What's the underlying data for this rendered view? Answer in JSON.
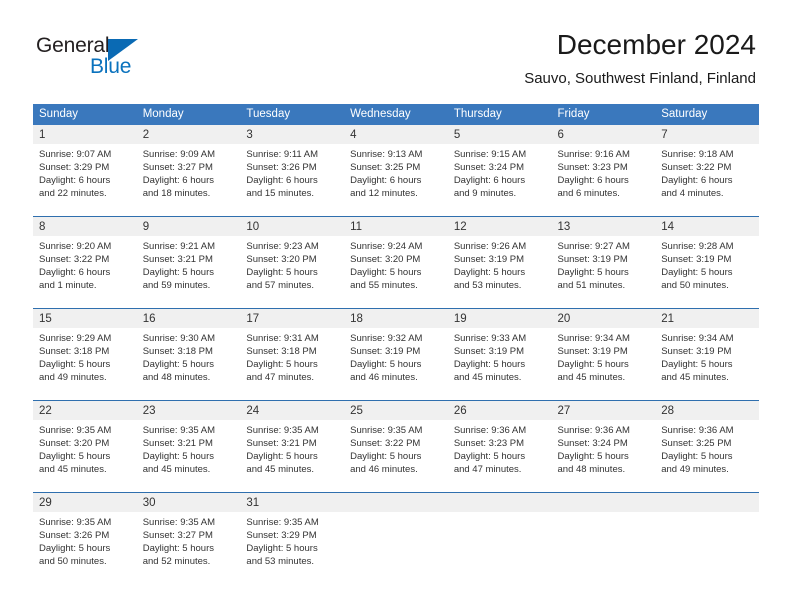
{
  "logo": {
    "word1": "General",
    "word2": "Blue",
    "triangle_color": "#0a6ab4",
    "blue_color": "#0a72bd"
  },
  "header": {
    "title": "December 2024",
    "subtitle": "Sauvo, Southwest Finland, Finland"
  },
  "theme": {
    "header_blue": "#3a78bd",
    "separator_blue": "#2f6fae",
    "day_band_gray": "#f0f0f0",
    "text": "#333333"
  },
  "calendar": {
    "day_headers": [
      "Sunday",
      "Monday",
      "Tuesday",
      "Wednesday",
      "Thursday",
      "Friday",
      "Saturday"
    ],
    "weeks": [
      [
        {
          "day": "1",
          "sunrise": "Sunrise: 9:07 AM",
          "sunset": "Sunset: 3:29 PM",
          "daylight1": "Daylight: 6 hours",
          "daylight2": "and 22 minutes."
        },
        {
          "day": "2",
          "sunrise": "Sunrise: 9:09 AM",
          "sunset": "Sunset: 3:27 PM",
          "daylight1": "Daylight: 6 hours",
          "daylight2": "and 18 minutes."
        },
        {
          "day": "3",
          "sunrise": "Sunrise: 9:11 AM",
          "sunset": "Sunset: 3:26 PM",
          "daylight1": "Daylight: 6 hours",
          "daylight2": "and 15 minutes."
        },
        {
          "day": "4",
          "sunrise": "Sunrise: 9:13 AM",
          "sunset": "Sunset: 3:25 PM",
          "daylight1": "Daylight: 6 hours",
          "daylight2": "and 12 minutes."
        },
        {
          "day": "5",
          "sunrise": "Sunrise: 9:15 AM",
          "sunset": "Sunset: 3:24 PM",
          "daylight1": "Daylight: 6 hours",
          "daylight2": "and 9 minutes."
        },
        {
          "day": "6",
          "sunrise": "Sunrise: 9:16 AM",
          "sunset": "Sunset: 3:23 PM",
          "daylight1": "Daylight: 6 hours",
          "daylight2": "and 6 minutes."
        },
        {
          "day": "7",
          "sunrise": "Sunrise: 9:18 AM",
          "sunset": "Sunset: 3:22 PM",
          "daylight1": "Daylight: 6 hours",
          "daylight2": "and 4 minutes."
        }
      ],
      [
        {
          "day": "8",
          "sunrise": "Sunrise: 9:20 AM",
          "sunset": "Sunset: 3:22 PM",
          "daylight1": "Daylight: 6 hours",
          "daylight2": "and 1 minute."
        },
        {
          "day": "9",
          "sunrise": "Sunrise: 9:21 AM",
          "sunset": "Sunset: 3:21 PM",
          "daylight1": "Daylight: 5 hours",
          "daylight2": "and 59 minutes."
        },
        {
          "day": "10",
          "sunrise": "Sunrise: 9:23 AM",
          "sunset": "Sunset: 3:20 PM",
          "daylight1": "Daylight: 5 hours",
          "daylight2": "and 57 minutes."
        },
        {
          "day": "11",
          "sunrise": "Sunrise: 9:24 AM",
          "sunset": "Sunset: 3:20 PM",
          "daylight1": "Daylight: 5 hours",
          "daylight2": "and 55 minutes."
        },
        {
          "day": "12",
          "sunrise": "Sunrise: 9:26 AM",
          "sunset": "Sunset: 3:19 PM",
          "daylight1": "Daylight: 5 hours",
          "daylight2": "and 53 minutes."
        },
        {
          "day": "13",
          "sunrise": "Sunrise: 9:27 AM",
          "sunset": "Sunset: 3:19 PM",
          "daylight1": "Daylight: 5 hours",
          "daylight2": "and 51 minutes."
        },
        {
          "day": "14",
          "sunrise": "Sunrise: 9:28 AM",
          "sunset": "Sunset: 3:19 PM",
          "daylight1": "Daylight: 5 hours",
          "daylight2": "and 50 minutes."
        }
      ],
      [
        {
          "day": "15",
          "sunrise": "Sunrise: 9:29 AM",
          "sunset": "Sunset: 3:18 PM",
          "daylight1": "Daylight: 5 hours",
          "daylight2": "and 49 minutes."
        },
        {
          "day": "16",
          "sunrise": "Sunrise: 9:30 AM",
          "sunset": "Sunset: 3:18 PM",
          "daylight1": "Daylight: 5 hours",
          "daylight2": "and 48 minutes."
        },
        {
          "day": "17",
          "sunrise": "Sunrise: 9:31 AM",
          "sunset": "Sunset: 3:18 PM",
          "daylight1": "Daylight: 5 hours",
          "daylight2": "and 47 minutes."
        },
        {
          "day": "18",
          "sunrise": "Sunrise: 9:32 AM",
          "sunset": "Sunset: 3:19 PM",
          "daylight1": "Daylight: 5 hours",
          "daylight2": "and 46 minutes."
        },
        {
          "day": "19",
          "sunrise": "Sunrise: 9:33 AM",
          "sunset": "Sunset: 3:19 PM",
          "daylight1": "Daylight: 5 hours",
          "daylight2": "and 45 minutes."
        },
        {
          "day": "20",
          "sunrise": "Sunrise: 9:34 AM",
          "sunset": "Sunset: 3:19 PM",
          "daylight1": "Daylight: 5 hours",
          "daylight2": "and 45 minutes."
        },
        {
          "day": "21",
          "sunrise": "Sunrise: 9:34 AM",
          "sunset": "Sunset: 3:19 PM",
          "daylight1": "Daylight: 5 hours",
          "daylight2": "and 45 minutes."
        }
      ],
      [
        {
          "day": "22",
          "sunrise": "Sunrise: 9:35 AM",
          "sunset": "Sunset: 3:20 PM",
          "daylight1": "Daylight: 5 hours",
          "daylight2": "and 45 minutes."
        },
        {
          "day": "23",
          "sunrise": "Sunrise: 9:35 AM",
          "sunset": "Sunset: 3:21 PM",
          "daylight1": "Daylight: 5 hours",
          "daylight2": "and 45 minutes."
        },
        {
          "day": "24",
          "sunrise": "Sunrise: 9:35 AM",
          "sunset": "Sunset: 3:21 PM",
          "daylight1": "Daylight: 5 hours",
          "daylight2": "and 45 minutes."
        },
        {
          "day": "25",
          "sunrise": "Sunrise: 9:35 AM",
          "sunset": "Sunset: 3:22 PM",
          "daylight1": "Daylight: 5 hours",
          "daylight2": "and 46 minutes."
        },
        {
          "day": "26",
          "sunrise": "Sunrise: 9:36 AM",
          "sunset": "Sunset: 3:23 PM",
          "daylight1": "Daylight: 5 hours",
          "daylight2": "and 47 minutes."
        },
        {
          "day": "27",
          "sunrise": "Sunrise: 9:36 AM",
          "sunset": "Sunset: 3:24 PM",
          "daylight1": "Daylight: 5 hours",
          "daylight2": "and 48 minutes."
        },
        {
          "day": "28",
          "sunrise": "Sunrise: 9:36 AM",
          "sunset": "Sunset: 3:25 PM",
          "daylight1": "Daylight: 5 hours",
          "daylight2": "and 49 minutes."
        }
      ],
      [
        {
          "day": "29",
          "sunrise": "Sunrise: 9:35 AM",
          "sunset": "Sunset: 3:26 PM",
          "daylight1": "Daylight: 5 hours",
          "daylight2": "and 50 minutes."
        },
        {
          "day": "30",
          "sunrise": "Sunrise: 9:35 AM",
          "sunset": "Sunset: 3:27 PM",
          "daylight1": "Daylight: 5 hours",
          "daylight2": "and 52 minutes."
        },
        {
          "day": "31",
          "sunrise": "Sunrise: 9:35 AM",
          "sunset": "Sunset: 3:29 PM",
          "daylight1": "Daylight: 5 hours",
          "daylight2": "and 53 minutes."
        },
        {
          "day": "",
          "sunrise": "",
          "sunset": "",
          "daylight1": "",
          "daylight2": ""
        },
        {
          "day": "",
          "sunrise": "",
          "sunset": "",
          "daylight1": "",
          "daylight2": ""
        },
        {
          "day": "",
          "sunrise": "",
          "sunset": "",
          "daylight1": "",
          "daylight2": ""
        },
        {
          "day": "",
          "sunrise": "",
          "sunset": "",
          "daylight1": "",
          "daylight2": ""
        }
      ]
    ]
  }
}
